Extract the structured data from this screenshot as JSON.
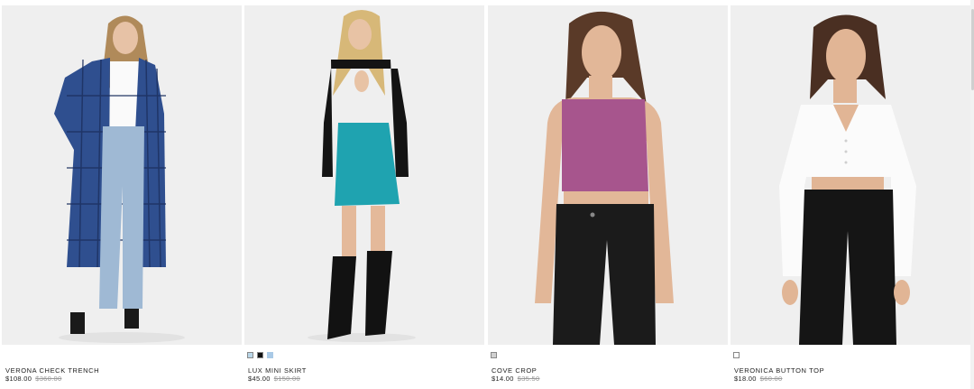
{
  "products": [
    {
      "name": "VERONA CHECK TRENCH",
      "price": "$108.00",
      "was_price": "$360.00",
      "image_label": "woman-in-blue-check-trench-coat",
      "swatches": []
    },
    {
      "name": "LUX MINI SKIRT",
      "price": "$45.00",
      "was_price": "$150.00",
      "image_label": "woman-in-teal-mini-skirt-and-black-top",
      "swatches": [
        "#b9d6e8",
        "#111111",
        "#a9c9e6"
      ]
    },
    {
      "name": "COVE CROP",
      "price": "$14.00",
      "was_price": "$35.50",
      "image_label": "woman-in-pink-knit-crop-top",
      "swatches": [
        "#d0d0d0"
      ]
    },
    {
      "name": "VERONICA BUTTON TOP",
      "price": "$18.00",
      "was_price": "$60.00",
      "image_label": "woman-in-white-button-crop-top",
      "swatches": [
        "#ffffff"
      ]
    }
  ],
  "colors": {
    "photo_background": "#eeeeee",
    "strikethrough": "#999999"
  }
}
